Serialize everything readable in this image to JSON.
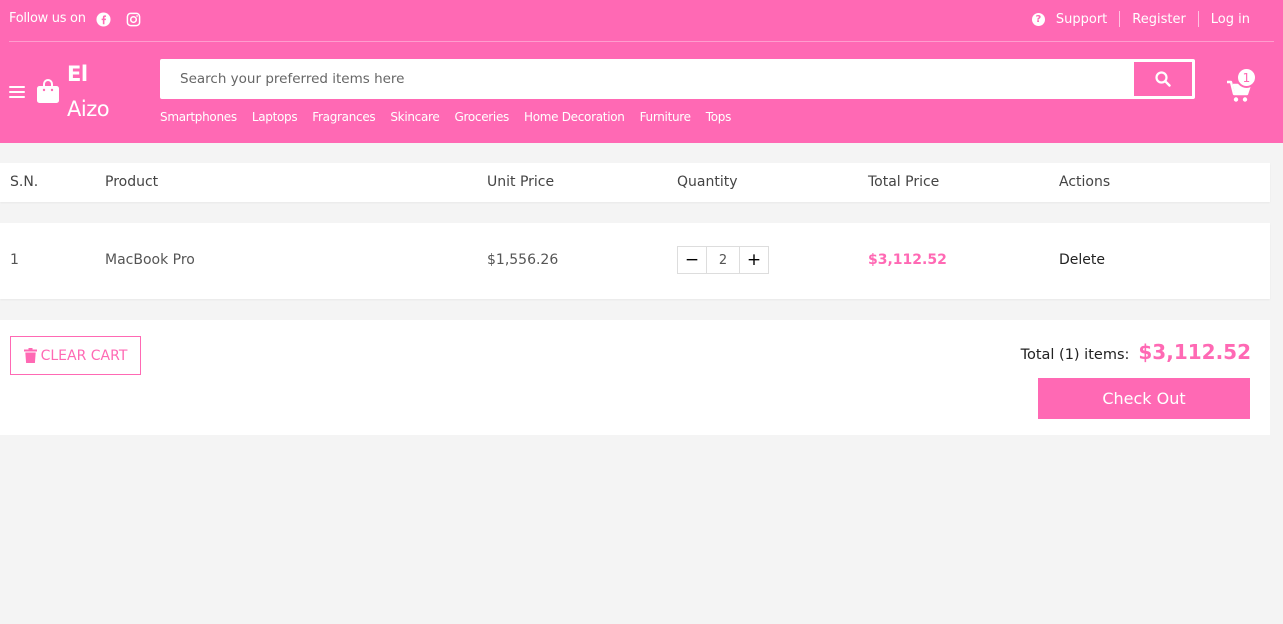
{
  "header": {
    "follow_text": "Follow us on",
    "links": {
      "support": "Support",
      "register": "Register",
      "login": "Log in"
    },
    "brand": {
      "line1": "El",
      "line2": "Aizo"
    },
    "search": {
      "placeholder": "Search your preferred items here",
      "value": ""
    },
    "categories": [
      "Smartphones",
      "Laptops",
      "Fragrances",
      "Skincare",
      "Groceries",
      "Home Decoration",
      "Furniture",
      "Tops"
    ],
    "cart_count": "1"
  },
  "table": {
    "headers": [
      "S.N.",
      "Product",
      "Unit Price",
      "Quantity",
      "Total Price",
      "Actions"
    ],
    "rows": [
      {
        "sn": "1",
        "product": "MacBook Pro",
        "unit_price": "$1,556.26",
        "quantity": "2",
        "total_price": "$3,112.52",
        "action": "Delete"
      }
    ]
  },
  "summary": {
    "clear_label": "CLEAR CART",
    "total_label": "Total (1) items:",
    "total_value": "$3,112.52",
    "checkout_label": "Check Out"
  },
  "colors": {
    "accent": "#ff69b4",
    "background": "#f4f4f4"
  },
  "icons": [
    "facebook-icon",
    "instagram-icon",
    "help-icon",
    "menu-icon",
    "shopping-bag-icon",
    "search-icon",
    "cart-icon",
    "trash-icon"
  ]
}
